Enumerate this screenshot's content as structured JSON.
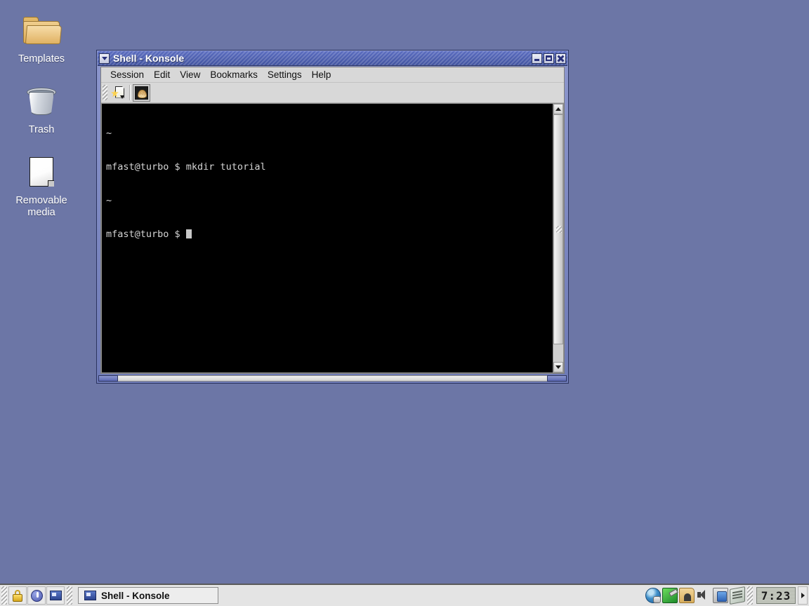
{
  "desktop": {
    "background_color": "#6c76a6",
    "icons": [
      {
        "label": "Templates",
        "icon": "folder-icon"
      },
      {
        "label": "Trash",
        "icon": "trash-icon"
      },
      {
        "label": "Removable media",
        "icon": "removable-media-icon"
      }
    ]
  },
  "window": {
    "title": "Shell - Konsole",
    "titlebar_color": "#41539f",
    "menu_button_icon": "chevron-down-icon",
    "controls": {
      "minimize": "–",
      "maximize": "□",
      "close": "✕"
    },
    "menus": [
      "Session",
      "Edit",
      "View",
      "Bookmarks",
      "Settings",
      "Help"
    ],
    "toolbar": [
      {
        "name": "new-session-button",
        "icon": "new-session-icon",
        "pressed": false
      },
      {
        "name": "shell-session-button",
        "icon": "shell-icon",
        "pressed": true
      }
    ],
    "terminal": {
      "background_color": "#000000",
      "text_color": "#d4d4d4",
      "lines": [
        "~",
        "mfast@turbo $ mkdir tutorial",
        "~",
        "mfast@turbo $ "
      ],
      "cursor": "block"
    },
    "scrollbar": {
      "up_arrow": "▲",
      "down_arrow": "▼",
      "thumb_position": "top"
    }
  },
  "taskbar": {
    "launchers": [
      {
        "name": "lock-screen-button",
        "icon": "lock-icon"
      },
      {
        "name": "logout-button",
        "icon": "power-icon"
      },
      {
        "name": "terminal-launcher-button",
        "icon": "screen-icon"
      }
    ],
    "tasks": [
      {
        "label": "Shell - Konsole",
        "icon": "screen-icon",
        "active": true
      }
    ],
    "tray": [
      {
        "name": "network-tray-icon",
        "icon": "globe-icon"
      },
      {
        "name": "package-tray-icon",
        "icon": "box-icon"
      },
      {
        "name": "home-folder-tray-icon",
        "icon": "folder-home-icon"
      },
      {
        "name": "volume-tray-icon",
        "icon": "speaker-icon"
      },
      {
        "name": "mixer-tray-icon",
        "icon": "mixer-icon"
      },
      {
        "name": "device-tray-icon",
        "icon": "scanner-icon"
      }
    ],
    "clock": "7:23",
    "expand_arrow_icon": "chevron-right-icon"
  }
}
